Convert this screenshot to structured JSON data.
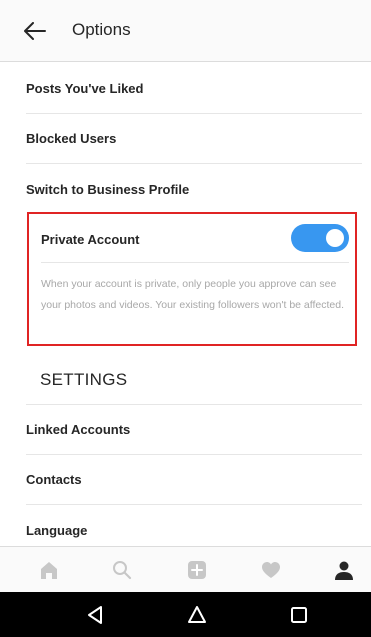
{
  "header": {
    "title": "Options",
    "back_icon": "arrow-left-icon"
  },
  "menu_items": [
    {
      "label": "Posts You've Liked"
    },
    {
      "label": "Blocked Users"
    },
    {
      "label": "Switch to Business Profile"
    }
  ],
  "private_account": {
    "label": "Private Account",
    "enabled": true,
    "description": "When your account is private, only people you approve can see your photos and videos. Your existing followers won't be affected.",
    "highlight_color": "#e02424"
  },
  "settings": {
    "title": "SETTINGS",
    "items": [
      {
        "label": "Linked Accounts"
      },
      {
        "label": "Contacts"
      },
      {
        "label": "Language"
      }
    ]
  },
  "tab_bar": {
    "tabs": [
      "home-icon",
      "search-icon",
      "add-post-icon",
      "heart-icon",
      "profile-icon"
    ],
    "active": "profile-icon"
  },
  "nav_bar": {
    "buttons": [
      "back-triangle-icon",
      "home-circle-icon",
      "recents-square-icon"
    ]
  },
  "colors": {
    "accent": "#3897f0",
    "text": "#262626",
    "muted": "#a8a8a8",
    "tab_inactive": "#c7c7c7"
  }
}
